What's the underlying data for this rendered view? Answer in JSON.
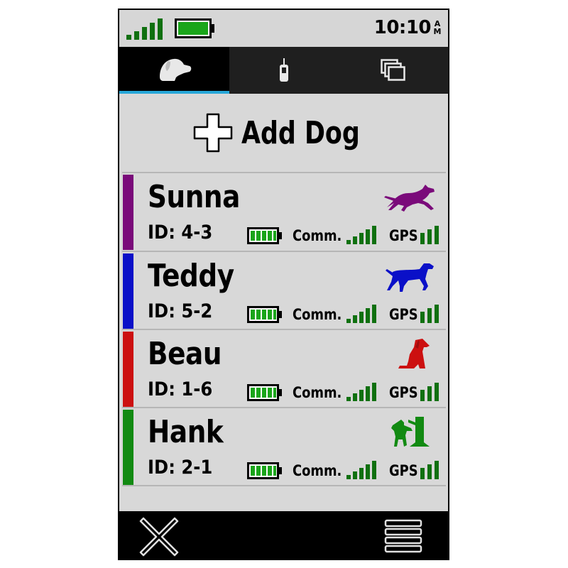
{
  "status_bar": {
    "time": "10:10",
    "am_pm": [
      "A",
      "M"
    ],
    "signal_strength": 5,
    "battery_level": 1.0,
    "battery_color": "#1aa51a"
  },
  "tabs": [
    {
      "name": "dogs",
      "icon": "dog-head-icon",
      "selected": true
    },
    {
      "name": "collar",
      "icon": "handheld-collar-icon",
      "selected": false
    },
    {
      "name": "pages",
      "icon": "pages-icon",
      "selected": false
    }
  ],
  "add_dog": {
    "label": "Add Dog",
    "icon": "plus-icon"
  },
  "dogs": [
    {
      "name": "Sunna",
      "id": "ID: 4-3",
      "color": "#7a0a7a",
      "icon": "running-dog-icon",
      "battery": 1.0,
      "comm_label": "Comm.",
      "comm_bars": 5,
      "gps_label": "GPS",
      "gps_bars": 3
    },
    {
      "name": "Teddy",
      "id": "ID: 5-2",
      "color": "#0a10c8",
      "icon": "pointing-dog-icon",
      "battery": 1.0,
      "comm_label": "Comm.",
      "comm_bars": 5,
      "gps_label": "GPS",
      "gps_bars": 3
    },
    {
      "name": "Beau",
      "id": "ID: 1-6",
      "color": "#cc1010",
      "icon": "sitting-dog-icon",
      "battery": 1.0,
      "comm_label": "Comm.",
      "comm_bars": 5,
      "gps_label": "GPS",
      "gps_bars": 3
    },
    {
      "name": "Hank",
      "id": "ID: 2-1",
      "color": "#128a12",
      "icon": "treed-dog-icon",
      "battery": 1.0,
      "comm_label": "Comm.",
      "comm_bars": 5,
      "gps_label": "GPS",
      "gps_bars": 3
    }
  ],
  "bottom_bar": {
    "close_icon": "close-icon",
    "menu_icon": "menu-icon"
  },
  "colors": {
    "accent": "#27a7d8",
    "signal_green": "#107010",
    "battery_green": "#1aa51a",
    "list_background": "#d8d8d8"
  }
}
